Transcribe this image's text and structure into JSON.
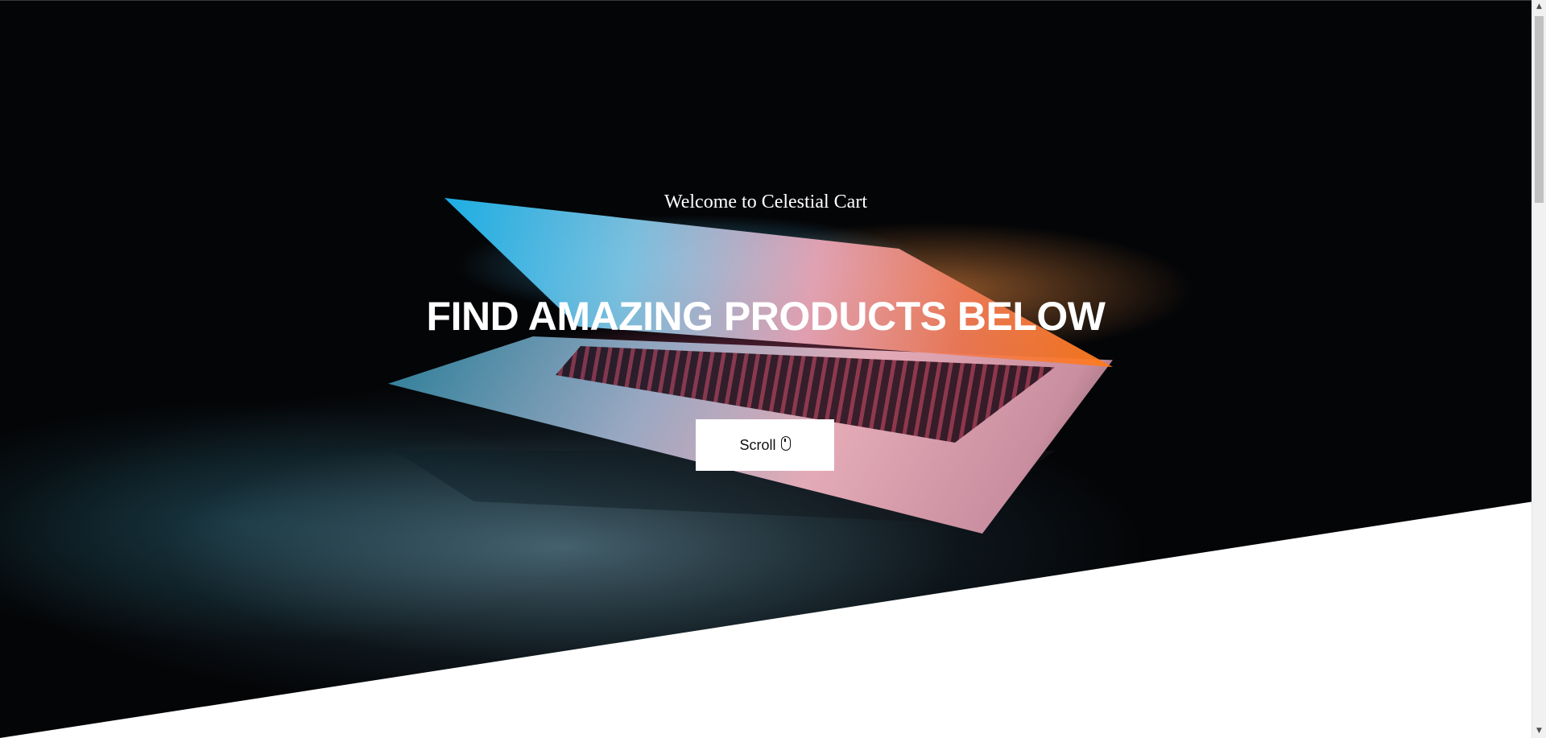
{
  "hero": {
    "welcome_text": "Welcome to Celestial Cart",
    "headline": "FIND AMAZING PRODUCTS BELOW",
    "scroll_button": {
      "label": "Scroll",
      "icon": "mouse-icon"
    }
  },
  "scrollbar": {
    "up_arrow": "▲",
    "down_arrow": "▼"
  },
  "colors": {
    "hero_background": "#040507",
    "text": "#ffffff",
    "button_background": "#ffffff",
    "button_text": "#111111",
    "page_background": "#ffffff"
  }
}
